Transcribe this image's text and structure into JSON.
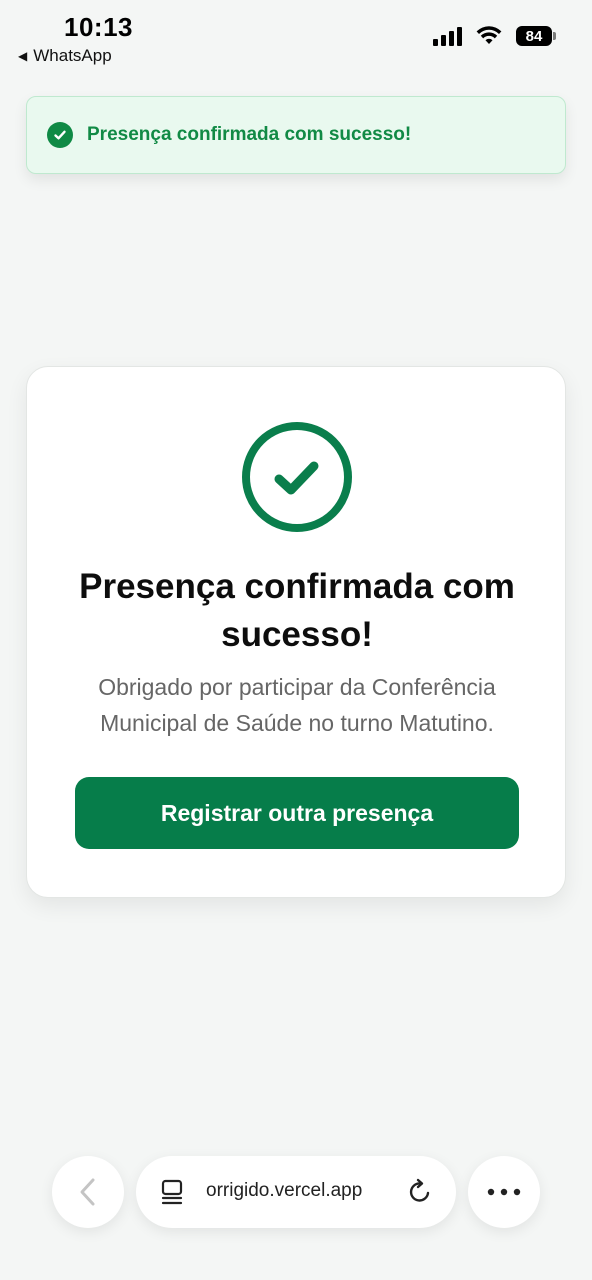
{
  "status_bar": {
    "time": "10:13",
    "back_app": "WhatsApp",
    "battery": "84"
  },
  "toast": {
    "message": "Presença confirmada com sucesso!"
  },
  "card": {
    "title": "Presença confirmada com sucesso!",
    "description": "Obrigado por participar da Conferência Municipal de Saúde no turno Matutino.",
    "button_label": "Registrar outra presença"
  },
  "browser_bar": {
    "url": "orrigido.vercel.app"
  },
  "colors": {
    "accent": "#067d4a",
    "toast_bg": "#e9f9ef",
    "toast_text": "#118a45"
  }
}
